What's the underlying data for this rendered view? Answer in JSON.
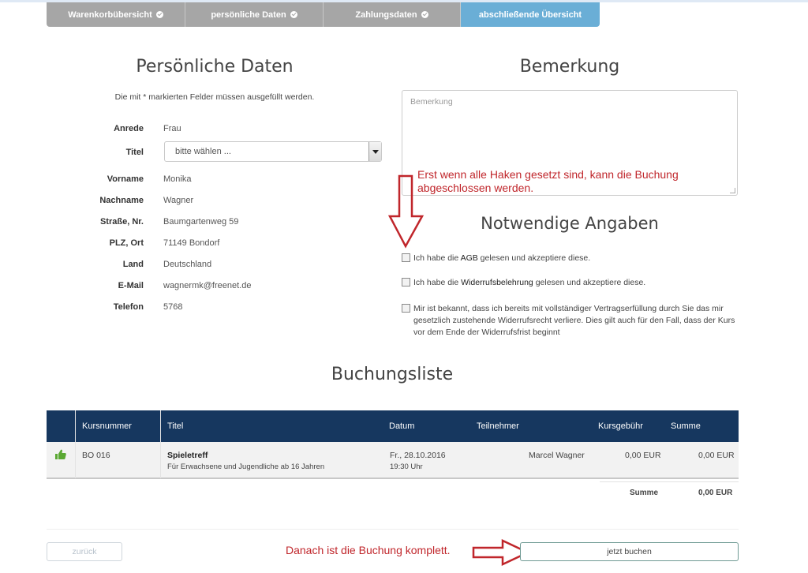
{
  "steps": [
    {
      "label": "Warenkorbübersicht",
      "done": true
    },
    {
      "label": "persönliche Daten",
      "done": true
    },
    {
      "label": "Zahlungsdaten",
      "done": true
    },
    {
      "label": "abschließende Übersicht",
      "active": true
    }
  ],
  "personal": {
    "title": "Persönliche Daten",
    "hint": "Die mit * markierten Felder müssen ausgefüllt werden.",
    "fields": [
      {
        "label": "Anrede",
        "value": "Frau"
      },
      {
        "label": "Titel",
        "value": "bitte wählen ..."
      },
      {
        "label": "Vorname",
        "value": "Monika"
      },
      {
        "label": "Nachname",
        "value": "Wagner"
      },
      {
        "label": "Straße, Nr.",
        "value": "Baumgartenweg 59"
      },
      {
        "label": "PLZ, Ort",
        "value": "71149 Bondorf"
      },
      {
        "label": "Land",
        "value": "Deutschland"
      },
      {
        "label": "E-Mail",
        "value": "wagnermk@freenet.de"
      },
      {
        "label": "Telefon",
        "value": "5768"
      }
    ]
  },
  "remark": {
    "title": "Bemerkung",
    "placeholder": "Bemerkung"
  },
  "annotation_checkboxes": "Erst wenn alle Haken gesetzt sind, kann die Buchung abgeschlossen werden.",
  "required": {
    "title": "Notwendige Angaben",
    "items": [
      {
        "pre": "Ich habe die ",
        "link": "AGB",
        "post": " gelesen und akzeptiere diese."
      },
      {
        "pre": "Ich habe die ",
        "link": "Widerrufsbelehrung",
        "post": " gelesen und akzeptiere diese."
      },
      {
        "pre": "Mir ist bekannt, dass ich bereits mit vollständiger Vertragserfüllung durch Sie das mir gesetzlich zustehende Widerrufsrecht verliere. Dies gilt auch für den Fall, dass der Kurs vor dem Ende der Widerrufsfrist beginnt",
        "link": "",
        "post": ""
      }
    ]
  },
  "booking": {
    "title": "Buchungsliste",
    "headers": [
      "Kursnummer",
      "Titel",
      "Datum",
      "Teilnehmer",
      "Kursgebühr",
      "Summe"
    ],
    "row": {
      "kursnummer": "BO 016",
      "titel": "Spieletreff",
      "untertitel": "Für Erwachsene und Jugendliche ab 16 Jahren",
      "datum": "Fr., 28.10.2016",
      "uhrzeit": "19:30 Uhr",
      "teilnehmer": "Marcel Wagner",
      "gebuehr": "0,00 EUR",
      "summe": "0,00 EUR"
    },
    "total_label": "Summe",
    "total_value": "0,00 EUR"
  },
  "buttons": {
    "back": "zurück",
    "book": "jetzt buchen"
  },
  "annotation_button": "Danach ist die Buchung komplett.",
  "colors": {
    "step_done": "#a6a6a6",
    "step_active": "#6aaed6",
    "table_header": "#16375f",
    "annotation": "#c0262b",
    "thumb": "#5aa832"
  }
}
